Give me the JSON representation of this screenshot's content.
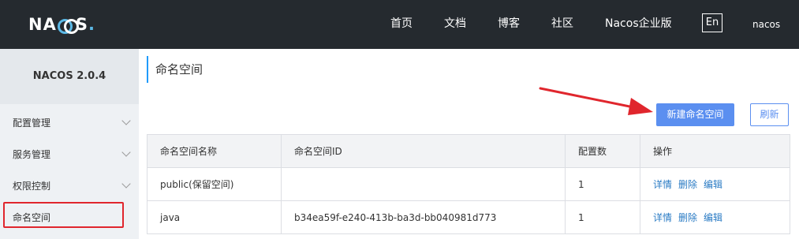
{
  "brand": {
    "logo_pre": "NA",
    "logo_post": "S",
    "logo_dot": "."
  },
  "nav": {
    "items": [
      "首页",
      "文档",
      "博客",
      "社区",
      "Nacos企业版"
    ],
    "lang": "En",
    "user": "nacos"
  },
  "sidebar": {
    "version": "NACOS 2.0.4",
    "items": [
      {
        "label": "配置管理"
      },
      {
        "label": "服务管理"
      },
      {
        "label": "权限控制"
      },
      {
        "label": "命名空间"
      }
    ]
  },
  "main": {
    "title": "命名空间",
    "create_button": "新建命名空间",
    "refresh_button": "刷新",
    "columns": [
      "命名空间名称",
      "命名空间ID",
      "配置数",
      "操作"
    ],
    "rows": [
      {
        "name": "public(保留空间)",
        "id": "",
        "count": "1",
        "ops": [
          "详情",
          "删除",
          "编辑"
        ]
      },
      {
        "name": "java",
        "id": "b34ea59f-e240-413b-ba3d-bb040981d773",
        "count": "1",
        "ops": [
          "详情",
          "删除",
          "编辑"
        ]
      }
    ]
  },
  "colors": {
    "topbar": "#252a2f",
    "accent": "#5b8ff0",
    "link": "#2a7bc4",
    "annotation": "#e0262d"
  }
}
